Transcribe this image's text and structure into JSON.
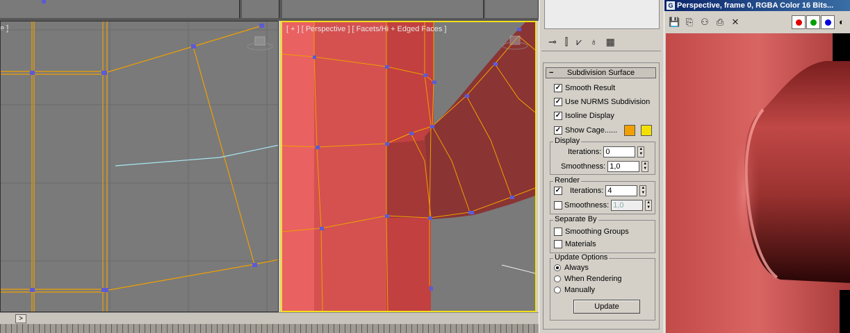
{
  "viewport_perspective": {
    "label": "[ + ] [ Perspective ] [ Facets/Hi + Edged Faces ]"
  },
  "viewport_left": {
    "label_fragment": "e ]"
  },
  "timeline": {
    "next_arrow": ">"
  },
  "command_panel": {
    "toolbar_icons": [
      "pin-stack-icon",
      "show-end-result-icon",
      "make-unique-icon",
      "remove-modifier-icon",
      "configure-modifier-sets-icon"
    ],
    "rollout": {
      "title": "Subdivision Surface",
      "collapse": "−",
      "smooth_result": {
        "label": "Smooth Result",
        "checked": true
      },
      "use_nurms": {
        "label": "Use NURMS Subdivision",
        "checked": true
      },
      "isoline_display": {
        "label": "Isoline Display",
        "checked": true
      },
      "show_cage": {
        "label": "Show Cage......",
        "checked": true,
        "color1": "#f0a000",
        "color2": "#f4e000"
      },
      "display": {
        "title": "Display",
        "iterations_label": "Iterations:",
        "iterations_value": "0",
        "smoothness_label": "Smoothness:",
        "smoothness_value": "1,0"
      },
      "render": {
        "title": "Render",
        "iterations_label": "Iterations:",
        "iterations_value": "4",
        "iterations_checked": true,
        "smoothness_label": "Smoothness:",
        "smoothness_value": "1,0",
        "smoothness_checked": false
      },
      "separate_by": {
        "title": "Separate By",
        "smoothing_groups": "Smoothing Groups",
        "materials": "Materials"
      },
      "update_options": {
        "title": "Update Options",
        "always": "Always",
        "when_rendering": "When Rendering",
        "manually": "Manually",
        "selected": "always",
        "update_button": "Update"
      }
    }
  },
  "render_window": {
    "title": "Perspective, frame 0, RGBA Color 16 Bits...",
    "toolbar_icons": [
      "save-icon",
      "copy-icon",
      "clone-icon",
      "print-icon",
      "clear-icon"
    ],
    "channels": [
      {
        "name": "red-channel",
        "color": "#e00000"
      },
      {
        "name": "green-channel",
        "color": "#00a000"
      },
      {
        "name": "blue-channel",
        "color": "#0000e0"
      }
    ]
  }
}
